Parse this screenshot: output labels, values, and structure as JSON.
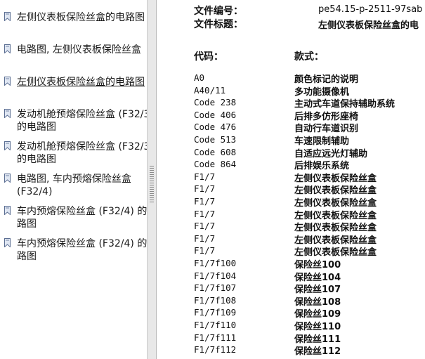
{
  "colors": {
    "grey_text": "#8a8a8a",
    "splitter": "#e8e8e8",
    "accent": "#1a4fa0"
  },
  "nav": {
    "items": [
      {
        "label": "左侧仪表板保险丝盒的电路图",
        "active": false
      },
      {
        "label": "电路图, 左侧仪表板保险丝盒",
        "active": false
      },
      {
        "label": "左侧仪表板保险丝盒的电路图",
        "active": true
      },
      {
        "label": "发动机舱预熔保险丝盒 (F32/3) 的电路图",
        "active": false
      },
      {
        "label": "发动机舱预熔保险丝盒 (F32/3) 的电路图",
        "active": false
      },
      {
        "label": "电路图, 车内预熔保险丝盒 (F32/4)",
        "active": false
      },
      {
        "label": "车内预熔保险丝盒 (F32/4) 的电路图",
        "active": false
      },
      {
        "label": "车内预熔保险丝盒 (F32/4) 的电路图",
        "active": false
      }
    ]
  },
  "doc": {
    "file_no_label": "文件编号：",
    "file_no_value": "pe54.15-p-2511-97sab",
    "file_title_label": "文件标题：",
    "file_title_value": "左侧仪表板保险丝盒的电",
    "code_header": "代码：",
    "desc_header": "款式：",
    "rows": [
      {
        "code": "A0",
        "desc": "颜色标记的说明"
      },
      {
        "code": "A40/11",
        "desc": "多功能摄像机"
      },
      {
        "code": "Code 238",
        "desc": "主动式车道保持辅助系统"
      },
      {
        "code": "Code 406",
        "desc": "后排多仿形座椅"
      },
      {
        "code": "Code 476",
        "desc": "自动行车道识别"
      },
      {
        "code": "Code 513",
        "desc": "车速限制辅助"
      },
      {
        "code": "Code 608",
        "desc": "自适应远光灯辅助"
      },
      {
        "code": "Code 864",
        "desc": "后排娱乐系统"
      },
      {
        "code": "F1/7",
        "desc": "左侧仪表板保险丝盒"
      },
      {
        "code": "F1/7",
        "desc": "左侧仪表板保险丝盒"
      },
      {
        "code": "F1/7",
        "desc": "左侧仪表板保险丝盒"
      },
      {
        "code": "F1/7",
        "desc": "左侧仪表板保险丝盒"
      },
      {
        "code": "F1/7",
        "desc": "左侧仪表板保险丝盒"
      },
      {
        "code": "F1/7",
        "desc": "左侧仪表板保险丝盒"
      },
      {
        "code": "F1/7",
        "desc": "左侧仪表板保险丝盒"
      },
      {
        "code": "F1/7f100",
        "desc": "保险丝100"
      },
      {
        "code": "F1/7f104",
        "desc": "保险丝104"
      },
      {
        "code": "F1/7f107",
        "desc": "保险丝107"
      },
      {
        "code": "F1/7f108",
        "desc": "保险丝108"
      },
      {
        "code": "F1/7f109",
        "desc": "保险丝109"
      },
      {
        "code": "F1/7f110",
        "desc": "保险丝110"
      },
      {
        "code": "F1/7f111",
        "desc": "保险丝111"
      },
      {
        "code": "F1/7f112",
        "desc": "保险丝112"
      }
    ]
  }
}
